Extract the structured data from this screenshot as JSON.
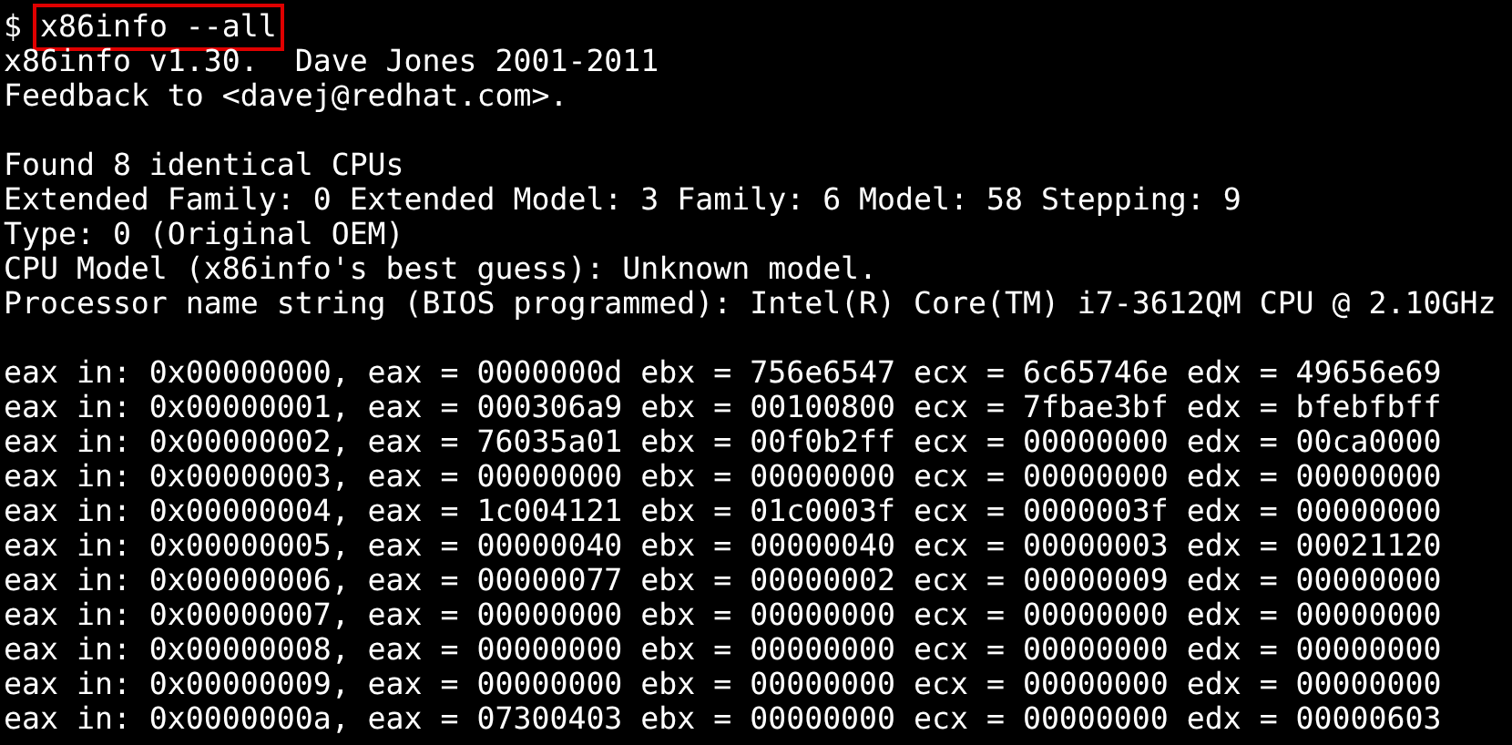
{
  "terminal": {
    "prompt": "$",
    "command": {
      "text": "x86info --all",
      "highlighted": true
    },
    "header_lines": [
      "x86info v1.30.  Dave Jones 2001-2011",
      "Feedback to <davej@redhat.com>."
    ],
    "cpu_lines": [
      "Found 8 identical CPUs",
      "Extended Family: 0 Extended Model: 3 Family: 6 Model: 58 Stepping: 9",
      "Type: 0 (Original OEM)",
      "CPU Model (x86info's best guess): Unknown model.",
      "Processor name string (BIOS programmed): Intel(R) Core(TM) i7-3612QM CPU @ 2.10GHz"
    ],
    "cpuid_lines": [
      "eax in: 0x00000000, eax = 0000000d ebx = 756e6547 ecx = 6c65746e edx = 49656e69",
      "eax in: 0x00000001, eax = 000306a9 ebx = 00100800 ecx = 7fbae3bf edx = bfebfbff",
      "eax in: 0x00000002, eax = 76035a01 ebx = 00f0b2ff ecx = 00000000 edx = 00ca0000",
      "eax in: 0x00000003, eax = 00000000 ebx = 00000000 ecx = 00000000 edx = 00000000",
      "eax in: 0x00000004, eax = 1c004121 ebx = 01c0003f ecx = 0000003f edx = 00000000",
      "eax in: 0x00000005, eax = 00000040 ebx = 00000040 ecx = 00000003 edx = 00021120",
      "eax in: 0x00000006, eax = 00000077 ebx = 00000002 ecx = 00000009 edx = 00000000",
      "eax in: 0x00000007, eax = 00000000 ebx = 00000000 ecx = 00000000 edx = 00000000",
      "eax in: 0x00000008, eax = 00000000 ebx = 00000000 ecx = 00000000 edx = 00000000",
      "eax in: 0x00000009, eax = 00000000 ebx = 00000000 ecx = 00000000 edx = 00000000",
      "eax in: 0x0000000a, eax = 07300403 ebx = 00000000 ecx = 00000000 edx = 00000603"
    ]
  }
}
